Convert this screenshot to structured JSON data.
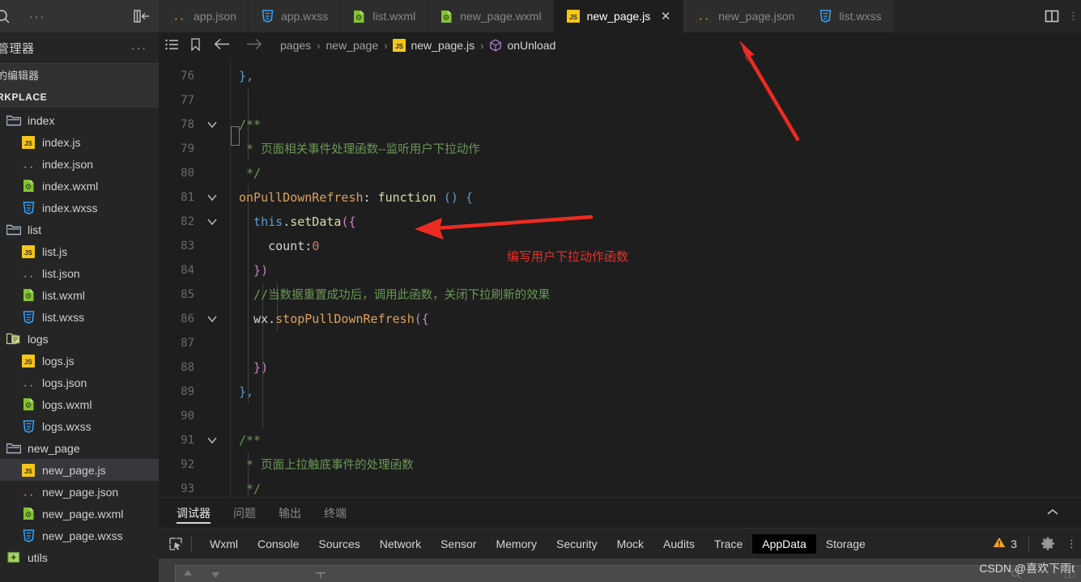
{
  "sidebar": {
    "toolbar": {
      "search_icon": "search-icon",
      "more_icon": "more-actions-icon",
      "collapse_icon": "collapse-sidebar-icon"
    },
    "title": "管理器",
    "title_more": "···",
    "section_open_editors": "的编辑器",
    "section_workspace": "RKPLACE",
    "tree": [
      {
        "label": "index",
        "type": "folder",
        "icon": "folder-icon",
        "depth": 0,
        "selected": false
      },
      {
        "label": "index.js",
        "type": "file",
        "icon": "js-icon",
        "depth": 1,
        "selected": false
      },
      {
        "label": "index.json",
        "type": "file",
        "icon": "json-icon",
        "depth": 1,
        "selected": false
      },
      {
        "label": "index.wxml",
        "type": "file",
        "icon": "wxml-icon",
        "depth": 1,
        "selected": false
      },
      {
        "label": "index.wxss",
        "type": "file",
        "icon": "wxss-icon",
        "depth": 1,
        "selected": false
      },
      {
        "label": "list",
        "type": "folder",
        "icon": "folder-icon",
        "depth": 0,
        "selected": false
      },
      {
        "label": "list.js",
        "type": "file",
        "icon": "js-icon",
        "depth": 1,
        "selected": false
      },
      {
        "label": "list.json",
        "type": "file",
        "icon": "json-icon",
        "depth": 1,
        "selected": false
      },
      {
        "label": "list.wxml",
        "type": "file",
        "icon": "wxml-icon",
        "depth": 1,
        "selected": false
      },
      {
        "label": "list.wxss",
        "type": "file",
        "icon": "wxss-icon",
        "depth": 1,
        "selected": false
      },
      {
        "label": "logs",
        "type": "folder",
        "icon": "folder-page-icon",
        "depth": 0,
        "selected": false
      },
      {
        "label": "logs.js",
        "type": "file",
        "icon": "js-icon",
        "depth": 1,
        "selected": false
      },
      {
        "label": "logs.json",
        "type": "file",
        "icon": "json-icon",
        "depth": 1,
        "selected": false
      },
      {
        "label": "logs.wxml",
        "type": "file",
        "icon": "wxml-icon",
        "depth": 1,
        "selected": false
      },
      {
        "label": "logs.wxss",
        "type": "file",
        "icon": "wxss-icon",
        "depth": 1,
        "selected": false
      },
      {
        "label": "new_page",
        "type": "folder",
        "icon": "folder-icon",
        "depth": 0,
        "selected": false
      },
      {
        "label": "new_page.js",
        "type": "file",
        "icon": "js-icon",
        "depth": 1,
        "selected": true
      },
      {
        "label": "new_page.json",
        "type": "file",
        "icon": "json-icon",
        "depth": 1,
        "selected": false
      },
      {
        "label": "new_page.wxml",
        "type": "file",
        "icon": "wxml-icon",
        "depth": 1,
        "selected": false
      },
      {
        "label": "new_page.wxss",
        "type": "file",
        "icon": "wxss-icon",
        "depth": 1,
        "selected": false
      },
      {
        "label": "utils",
        "type": "folder",
        "icon": "folder-plus-icon",
        "depth": 0,
        "selected": false
      }
    ]
  },
  "tabbar": {
    "tabs": [
      {
        "label": "app.json",
        "icon": "json-icon",
        "active": false,
        "closable": false
      },
      {
        "label": "app.wxss",
        "icon": "wxss-icon",
        "active": false,
        "closable": false
      },
      {
        "label": "list.wxml",
        "icon": "wxml-icon",
        "active": false,
        "closable": false
      },
      {
        "label": "new_page.wxml",
        "icon": "wxml-icon",
        "active": false,
        "closable": false
      },
      {
        "label": "new_page.js",
        "icon": "js-icon",
        "active": true,
        "closable": true
      },
      {
        "label": "new_page.json",
        "icon": "json-icon",
        "active": false,
        "closable": false
      },
      {
        "label": "list.wxss",
        "icon": "wxss-icon",
        "active": false,
        "closable": false
      }
    ],
    "close_glyph": "✕",
    "split_icon": "split-editor-icon",
    "more_icon": "editor-actions-more-icon"
  },
  "breadcrumb": {
    "outline_icon": "outline-list-icon",
    "bookmark_icon": "bookmark-icon",
    "back_icon": "navigate-back-icon",
    "forward_icon": "navigate-forward-icon",
    "separator": "›",
    "crumbs": [
      {
        "label": "pages",
        "icon": null,
        "bright": false
      },
      {
        "label": "new_page",
        "icon": null,
        "bright": false
      },
      {
        "label": "new_page.js",
        "icon": "js-icon",
        "bright": true
      },
      {
        "label": "onUnload",
        "icon": "symbol-method-icon",
        "bright": true
      }
    ]
  },
  "editor": {
    "lines": [
      {
        "num": "76",
        "fold": false
      },
      {
        "num": "77",
        "fold": false
      },
      {
        "num": "78",
        "fold": true
      },
      {
        "num": "79",
        "fold": false
      },
      {
        "num": "80",
        "fold": false
      },
      {
        "num": "81",
        "fold": true
      },
      {
        "num": "82",
        "fold": true
      },
      {
        "num": "83",
        "fold": false
      },
      {
        "num": "84",
        "fold": false
      },
      {
        "num": "85",
        "fold": false
      },
      {
        "num": "86",
        "fold": true
      },
      {
        "num": "87",
        "fold": false
      },
      {
        "num": "88",
        "fold": false
      },
      {
        "num": "89",
        "fold": false
      },
      {
        "num": "90",
        "fold": false
      },
      {
        "num": "91",
        "fold": true
      },
      {
        "num": "92",
        "fold": false
      },
      {
        "num": "93",
        "fold": false
      }
    ],
    "code": {
      "l76_brace": "}",
      "l76_comma": ",",
      "l78": "/**",
      "l79_star": " * ",
      "l79_text": "页面相关事件处理函数--监听用户下拉动作",
      "l80": " */",
      "l81_name": "onPullDownRefresh",
      "l81_colon": ": ",
      "l81_kw": "function",
      "l81_paren": " ()",
      "l81_brace": " {",
      "l82_this": "  this",
      "l82_dot": ".",
      "l82_method": "setData",
      "l82_open": "({",
      "l83_prop": "    count",
      "l83_colon": ":",
      "l83_val": "0",
      "l84": "  })",
      "l85_slash": "  //",
      "l85_text": "当数据重置成功后，调用此函数，关闭下拉刷新的效果",
      "l86_obj": "  wx",
      "l86_dot": ".",
      "l86_method": "stopPullDownRefresh",
      "l86_open": "({",
      "l88": "  })",
      "l89": "},",
      "l91": "/**",
      "l92_star": " * ",
      "l92_text": "页面上拉触底事件的处理函数",
      "l93": " */"
    }
  },
  "annotations": {
    "note_text": "编写用户下拉动作函数",
    "arrow_color": "#ee2b22",
    "arrow_tab_name": "arrow-to-active-tab",
    "arrow_code_name": "arrow-to-setdata"
  },
  "panel": {
    "tabs": [
      {
        "label": "调试器",
        "active": true
      },
      {
        "label": "问题",
        "active": false
      },
      {
        "label": "输出",
        "active": false
      },
      {
        "label": "终端",
        "active": false
      }
    ],
    "collapse_icon": "chevron-up-icon"
  },
  "devtools": {
    "inspect_icon": "inspect-element-icon",
    "tabs": [
      {
        "label": "Wxml",
        "active": false
      },
      {
        "label": "Console",
        "active": false
      },
      {
        "label": "Sources",
        "active": false
      },
      {
        "label": "Network",
        "active": false
      },
      {
        "label": "Sensor",
        "active": false
      },
      {
        "label": "Memory",
        "active": false
      },
      {
        "label": "Security",
        "active": false
      },
      {
        "label": "Mock",
        "active": false
      },
      {
        "label": "Audits",
        "active": false
      },
      {
        "label": "Trace",
        "active": false
      },
      {
        "label": "AppData",
        "active": true
      },
      {
        "label": "Storage",
        "active": false
      }
    ],
    "warning_icon": "warning-triangle-icon",
    "warning_count": "3",
    "settings_icon": "gear-icon",
    "more_icon": "devtools-more-icon"
  },
  "watermark": {
    "text": "CSDN @喜欢下雨t"
  }
}
